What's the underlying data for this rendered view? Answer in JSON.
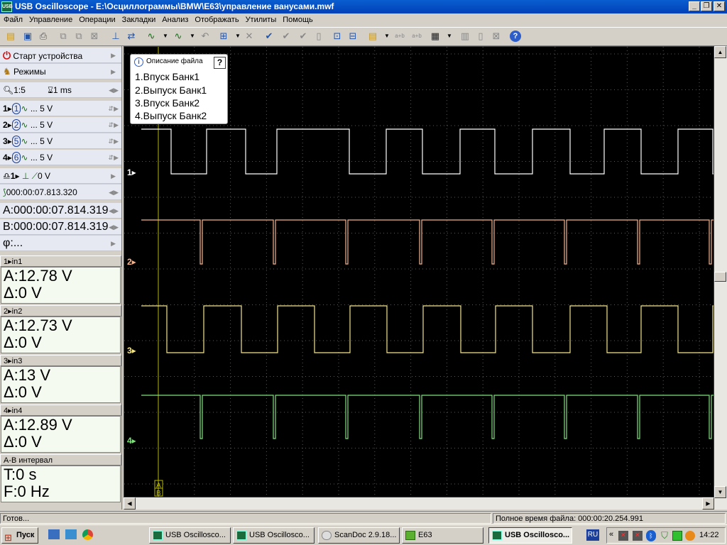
{
  "window": {
    "title": "USB Oscilloscope - E:\\Осциллограммы\\BMW\\E63\\управление ванусами.mwf",
    "app_icon_text": "USB"
  },
  "menu": [
    "Файл",
    "Управление",
    "Операции",
    "Закладки",
    "Анализ",
    "Отображать",
    "Утилиты",
    "Помощь"
  ],
  "toolbar": {
    "icons": [
      "open-icon",
      "save-icon",
      "print-icon",
      "copy-icon",
      "paste-icon",
      "delete-icon",
      "cursor-icon",
      "move-icon",
      "filter-icon",
      "filter2-icon",
      "undo-icon",
      "zoom-icon",
      "close-icon",
      "check-icon",
      "check2-icon",
      "check3-icon",
      "page-icon",
      "grid-icon",
      "export-icon",
      "formula-icon",
      "formula2-icon",
      "formula3-icon",
      "table-icon",
      "chart-icon",
      "doc-icon",
      "cross-icon",
      "help-icon"
    ]
  },
  "left_panel": {
    "start_device": "Старт устройства",
    "modes": "Режимы",
    "zoom": "1:5",
    "time_div": "1 ms",
    "channels": [
      {
        "num": "1",
        "circle": "1",
        "volts": "... 5 V"
      },
      {
        "num": "2",
        "circle": "2",
        "volts": "... 5 V"
      },
      {
        "num": "3",
        "circle": "5",
        "volts": "... 5 V"
      },
      {
        "num": "4",
        "circle": "6",
        "volts": "... 5 V"
      }
    ],
    "trigger_channel": "1",
    "trigger_level": "0 V",
    "trigger_time": "000:00:07.813.320",
    "cursor_a": "A:000:00:07.814.319",
    "cursor_b": "B:000:00:07.814.319",
    "phi": "φ:..."
  },
  "measurements": [
    {
      "label": "1▸in1",
      "a": "A:12.78 V",
      "d": "Δ:0 V"
    },
    {
      "label": "2▸in2",
      "a": "A:12.73 V",
      "d": "Δ:0 V"
    },
    {
      "label": "3▸in3",
      "a": "A:13 V",
      "d": "Δ:0 V"
    },
    {
      "label": "4▸in4",
      "a": "A:12.89 V",
      "d": "Δ:0 V"
    }
  ],
  "interval": {
    "label": "A-B интервал",
    "t": "T:0 s",
    "f": "F:0 Hz"
  },
  "file_description": {
    "title": "Описание файла",
    "help": "?",
    "lines": [
      "1.Впуск Банк1",
      "2.Выпуск Банк1",
      "3.Впуск Банк2",
      "4.Выпуск Банк2"
    ]
  },
  "channel_labels": [
    "1▸",
    "2▸",
    "3▸",
    "4▸"
  ],
  "cursor_marker": [
    "A",
    "B"
  ],
  "colors": {
    "ch1": "#ffffff",
    "ch2": "#f6b48c",
    "ch3": "#f5e68a",
    "ch4": "#7de27a",
    "grid": "#5a5a5a",
    "cursor": "#b8b800"
  },
  "status": {
    "left": "Готов...",
    "right": "Полное время файла: 000:00:20.254.991"
  },
  "taskbar": {
    "start": "Пуск",
    "tasks": [
      "USB Oscillosco...",
      "USB Oscillosco...",
      "ScanDoc 2.9.18...",
      "E63",
      "USB Oscillosco..."
    ],
    "lang": "RU",
    "time": "14:22"
  }
}
